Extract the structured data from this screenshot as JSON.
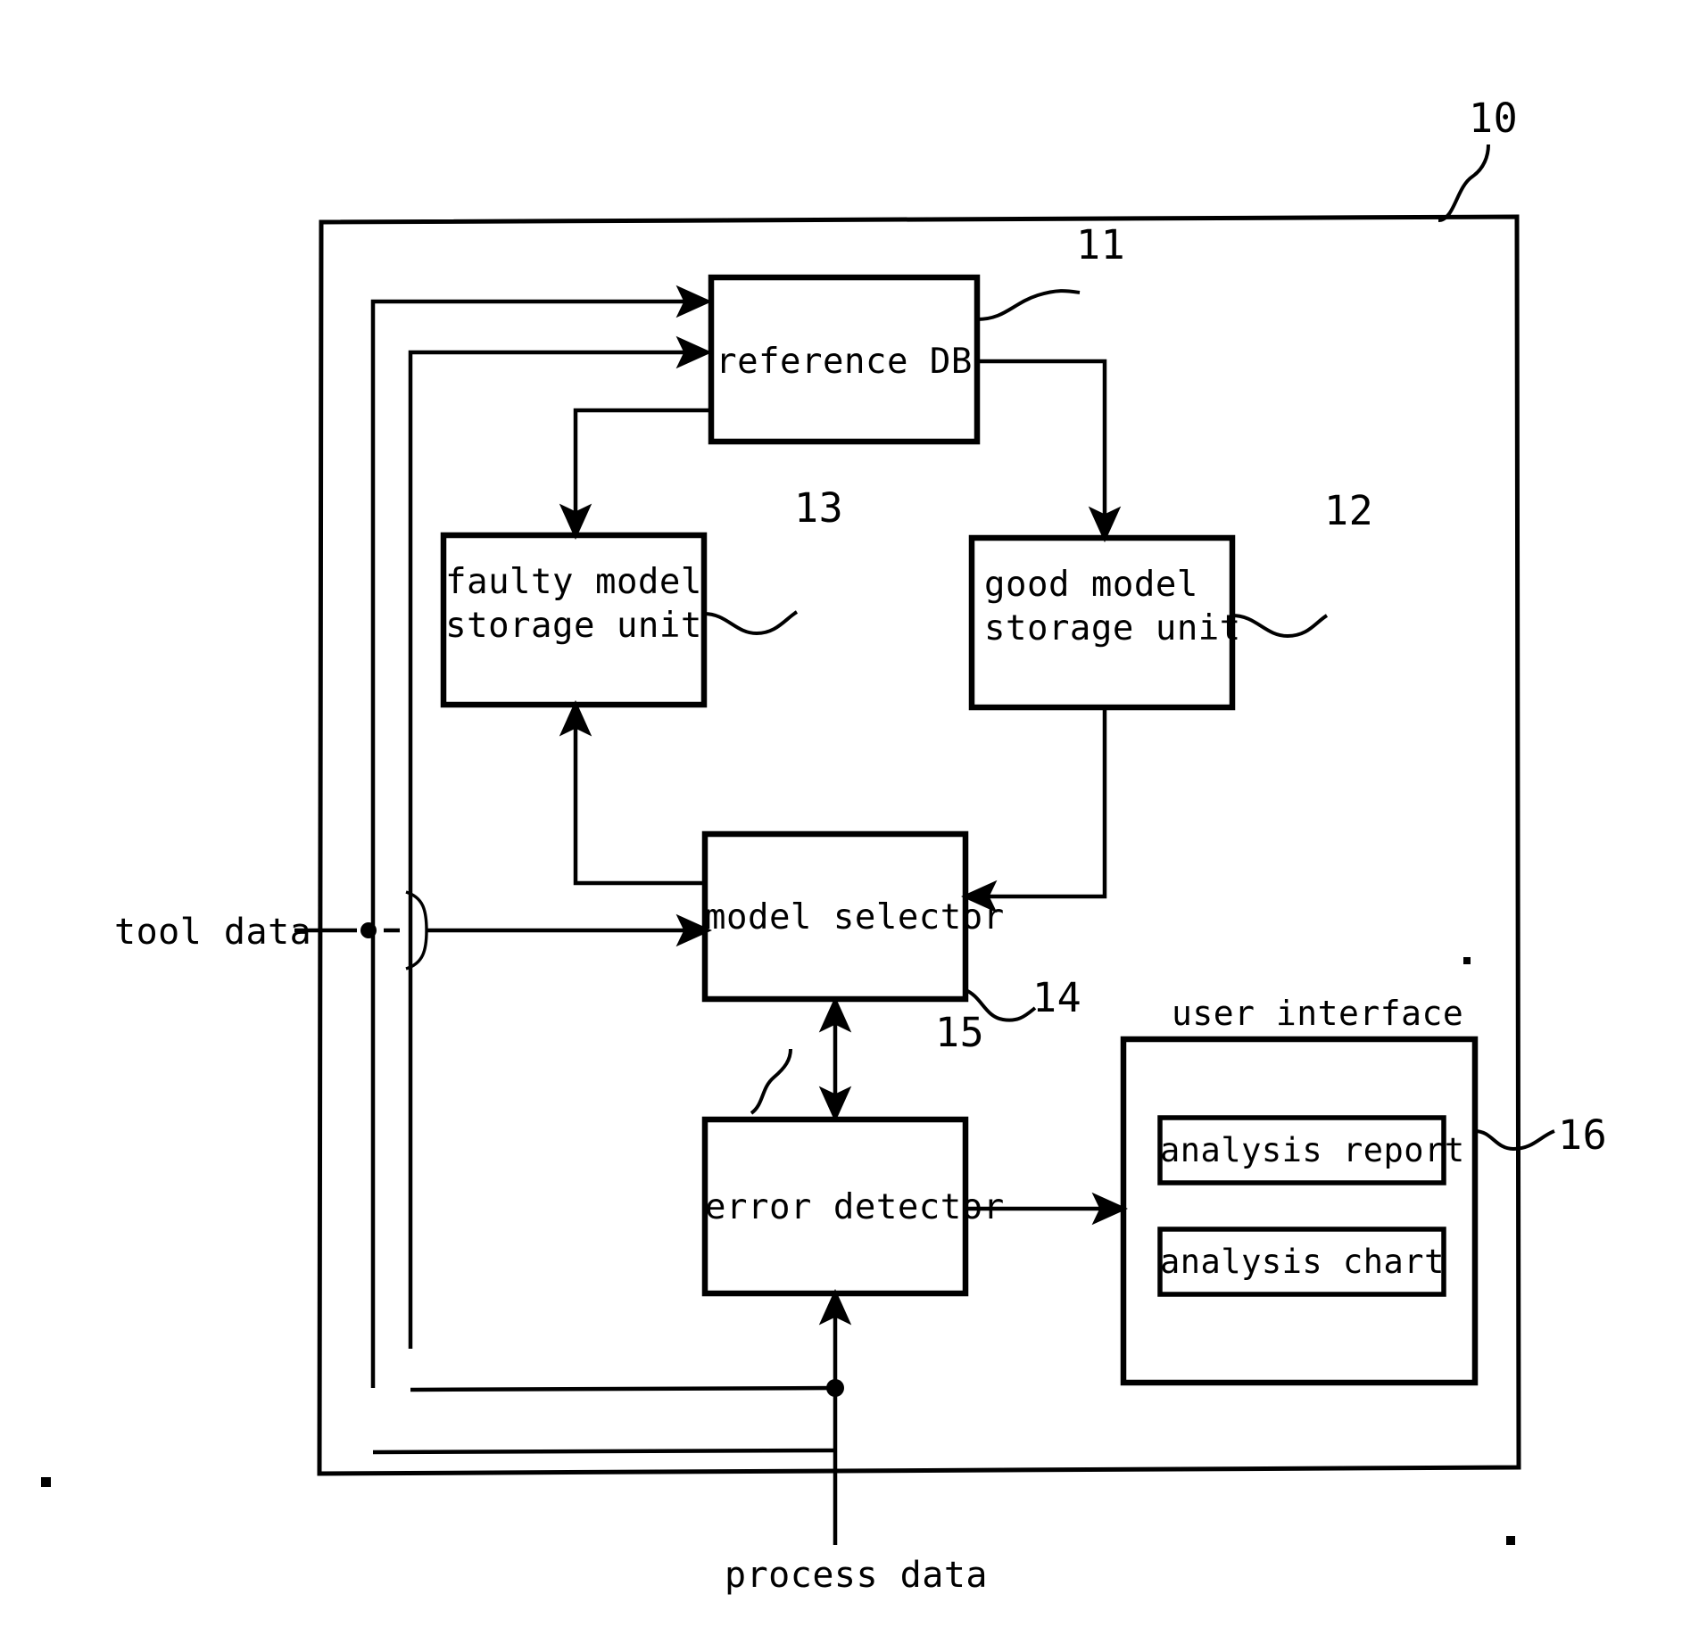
{
  "figure": {
    "type": "patent-block-diagram",
    "system_ref": "10"
  },
  "blocks": [
    {
      "id": "reference-db",
      "label": "reference DB",
      "ref": "11"
    },
    {
      "id": "good-model-storage",
      "label": "good model\nstorage unit",
      "ref": "12"
    },
    {
      "id": "faulty-model-storage",
      "label": "faulty model\nstorage unit",
      "ref": "13"
    },
    {
      "id": "model-selector",
      "label": "model selector",
      "ref": "14"
    },
    {
      "id": "error-detector",
      "label": "error detector",
      "ref": "15"
    },
    {
      "id": "user-interface",
      "label": "user interface",
      "ref": "16"
    }
  ],
  "block_labels": {
    "reference_db": "reference DB",
    "good_model_line1": "good model",
    "good_model_line2": "storage unit",
    "faulty_model_line1": "faulty model",
    "faulty_model_line2": "storage unit",
    "model_selector": "model selector",
    "error_detector": "error detector",
    "user_interface": "user interface",
    "analysis_report": "analysis report",
    "analysis_chart": "analysis chart"
  },
  "reference_numerals": {
    "system": "10",
    "reference_db": "11",
    "good_model_storage": "12",
    "faulty_model_storage": "13",
    "model_selector": "14",
    "error_detector": "15",
    "user_interface": "16"
  },
  "io_labels": {
    "tool_data": "tool data",
    "process_data": "process data"
  },
  "ui_children": [
    {
      "id": "analysis-report",
      "label": "analysis report"
    },
    {
      "id": "analysis-chart",
      "label": "analysis chart"
    }
  ],
  "colors": {
    "ink": "#000000",
    "paper": "#ffffff"
  }
}
